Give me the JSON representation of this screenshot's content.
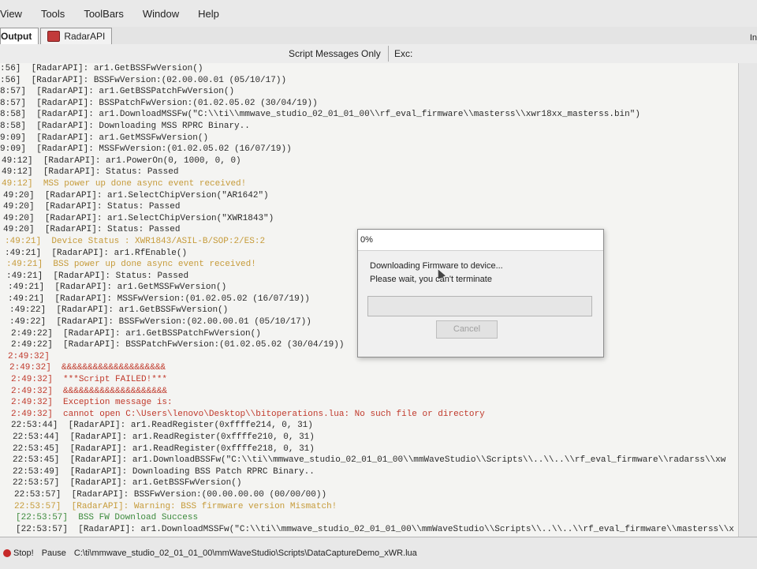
{
  "menubar": {
    "items": [
      "View",
      "Tools",
      "ToolBars",
      "Window",
      "Help"
    ]
  },
  "tabs": {
    "items": [
      "Output",
      "RadarAPI"
    ],
    "right_label": "In"
  },
  "filterbar": {
    "filter": "Script Messages Only",
    "exc": "Exc:"
  },
  "console": {
    "lines": [
      {
        "ts": ":56]",
        "msg": "[RadarAPI]: ar1.GetBSSFwVersion()",
        "type": "normal"
      },
      {
        "ts": ":56]",
        "msg": "[RadarAPI]: BSSFwVersion:(02.00.00.01 (05/10/17))",
        "type": "normal"
      },
      {
        "ts": "8:57]",
        "msg": "[RadarAPI]: ar1.GetBSSPatchFwVersion()",
        "type": "normal"
      },
      {
        "ts": "8:57]",
        "msg": "[RadarAPI]: BSSPatchFwVersion:(01.02.05.02 (30/04/19))",
        "type": "normal"
      },
      {
        "ts": "8:58]",
        "msg": "[RadarAPI]: ar1.DownloadMSSFw(\"C:\\\\ti\\\\mmwave_studio_02_01_01_00\\\\rf_eval_firmware\\\\masterss\\\\xwr18xx_masterss.bin\")",
        "type": "normal"
      },
      {
        "ts": "8:58]",
        "msg": "[RadarAPI]: Downloading MSS RPRC Binary..",
        "type": "normal"
      },
      {
        "ts": "9:09]",
        "msg": "[RadarAPI]: ar1.GetMSSFwVersion()",
        "type": "normal"
      },
      {
        "ts": "9:09]",
        "msg": "[RadarAPI]: MSSFwVersion:(01.02.05.02 (16/07/19))",
        "type": "normal"
      },
      {
        "ts": "49:12]",
        "msg": "[RadarAPI]: ar1.PowerOn(0, 1000, 0, 0)",
        "type": "normal"
      },
      {
        "ts": "49:12]",
        "msg": "[RadarAPI]: Status: Passed",
        "type": "normal"
      },
      {
        "ts": "49:12]",
        "msg": "MSS power up done async event received!",
        "type": "warn"
      },
      {
        "ts": "49:20]",
        "msg": "[RadarAPI]: ar1.SelectChipVersion(\"AR1642\")",
        "type": "normal"
      },
      {
        "ts": "49:20]",
        "msg": "[RadarAPI]: Status: Passed",
        "type": "normal"
      },
      {
        "ts": "49:20]",
        "msg": "[RadarAPI]: ar1.SelectChipVersion(\"XWR1843\")",
        "type": "normal"
      },
      {
        "ts": "49:20]",
        "msg": "[RadarAPI]: Status: Passed",
        "type": "normal"
      },
      {
        "ts": ":49:21]",
        "msg": "Device Status : XWR1843/ASIL-B/SOP:2/ES:2",
        "type": "warn"
      },
      {
        "ts": ":49:21]",
        "msg": "[RadarAPI]: ar1.RfEnable()",
        "type": "normal"
      },
      {
        "ts": ":49:21]",
        "msg": "BSS power up done async event received!",
        "type": "warn"
      },
      {
        "ts": ":49:21]",
        "msg": "[RadarAPI]: Status: Passed",
        "type": "normal"
      },
      {
        "ts": ":49:21]",
        "msg": "[RadarAPI]: ar1.GetMSSFwVersion()",
        "type": "normal"
      },
      {
        "ts": ":49:21]",
        "msg": "[RadarAPI]: MSSFwVersion:(01.02.05.02 (16/07/19))",
        "type": "normal"
      },
      {
        "ts": ":49:22]",
        "msg": "[RadarAPI]: ar1.GetBSSFwVersion()",
        "type": "normal"
      },
      {
        "ts": ":49:22]",
        "msg": "[RadarAPI]: BSSFwVersion:(02.00.00.01 (05/10/17))",
        "type": "normal"
      },
      {
        "ts": "2:49:22]",
        "msg": "[RadarAPI]: ar1.GetBSSPatchFwVersion()",
        "type": "normal"
      },
      {
        "ts": "2:49:22]",
        "msg": "[RadarAPI]: BSSPatchFwVersion:(01.02.05.02 (30/04/19))",
        "type": "normal"
      },
      {
        "ts": "2:49:32]",
        "msg": "",
        "type": "error"
      },
      {
        "ts": "2:49:32]",
        "msg": "&&&&&&&&&&&&&&&&&&&&",
        "type": "error"
      },
      {
        "ts": "2:49:32]",
        "msg": "***Script FAILED!***",
        "type": "error"
      },
      {
        "ts": "2:49:32]",
        "msg": "&&&&&&&&&&&&&&&&&&&&",
        "type": "error"
      },
      {
        "ts": "2:49:32]",
        "msg": "Exception message is:",
        "type": "error"
      },
      {
        "ts": "2:49:32]",
        "msg": "cannot open C:\\Users\\lenovo\\Desktop\\\\bitoperations.lua: No such file or directory",
        "type": "error"
      },
      {
        "ts": "22:53:44]",
        "msg": "[RadarAPI]: ar1.ReadRegister(0xffffe214, 0, 31)",
        "type": "normal"
      },
      {
        "ts": "22:53:44]",
        "msg": "[RadarAPI]: ar1.ReadRegister(0xffffe210, 0, 31)",
        "type": "normal"
      },
      {
        "ts": "22:53:45]",
        "msg": "[RadarAPI]: ar1.ReadRegister(0xffffe218, 0, 31)",
        "type": "normal"
      },
      {
        "ts": "22:53:45]",
        "msg": "[RadarAPI]: ar1.DownloadBSSFw(\"C:\\\\ti\\\\mmwave_studio_02_01_01_00\\\\mmWaveStudio\\\\Scripts\\\\..\\\\..\\\\rf_eval_firmware\\\\radarss\\\\xw",
        "type": "normal"
      },
      {
        "ts": "22:53:49]",
        "msg": "[RadarAPI]: Downloading BSS Patch RPRC Binary..",
        "type": "normal"
      },
      {
        "ts": "22:53:57]",
        "msg": "[RadarAPI]: ar1.GetBSSFwVersion()",
        "type": "normal"
      },
      {
        "ts": "22:53:57]",
        "msg": "[RadarAPI]: BSSFwVersion:(00.00.00.00 (00/00/00))",
        "type": "normal"
      },
      {
        "ts": "22:53:57]",
        "msg": "[RadarAPI]: Warning: BSS firmware version Mismatch!",
        "type": "warn"
      },
      {
        "ts": "[22:53:57]",
        "msg": "BSS FW Download Success",
        "type": "success"
      },
      {
        "ts": "[22:53:57]",
        "msg": "[RadarAPI]: ar1.DownloadMSSFw(\"C:\\\\ti\\\\mmwave_studio_02_01_01_00\\\\mmWaveStudio\\\\Scripts\\\\..\\\\..\\\\rf_eval_firmware\\\\masterss\\\\x",
        "type": "normal"
      }
    ]
  },
  "dialog": {
    "title": "0%",
    "message1": "Downloading Firmware to device...",
    "message2": "Please wait, you can't terminate",
    "progress": 0,
    "cancel_label": "Cancel"
  },
  "statusbar": {
    "stop": "Stop!",
    "pause": "Pause",
    "path": "C:\\ti\\mmwave_studio_02_01_01_00\\mmWaveStudio\\Scripts\\DataCaptureDemo_xWR.lua"
  },
  "colors": {
    "normal": "#2a2a2a",
    "warn": "#c69b3a",
    "error": "#c0392b",
    "success": "#3c8a3c",
    "stop_icon": "#c62828"
  }
}
